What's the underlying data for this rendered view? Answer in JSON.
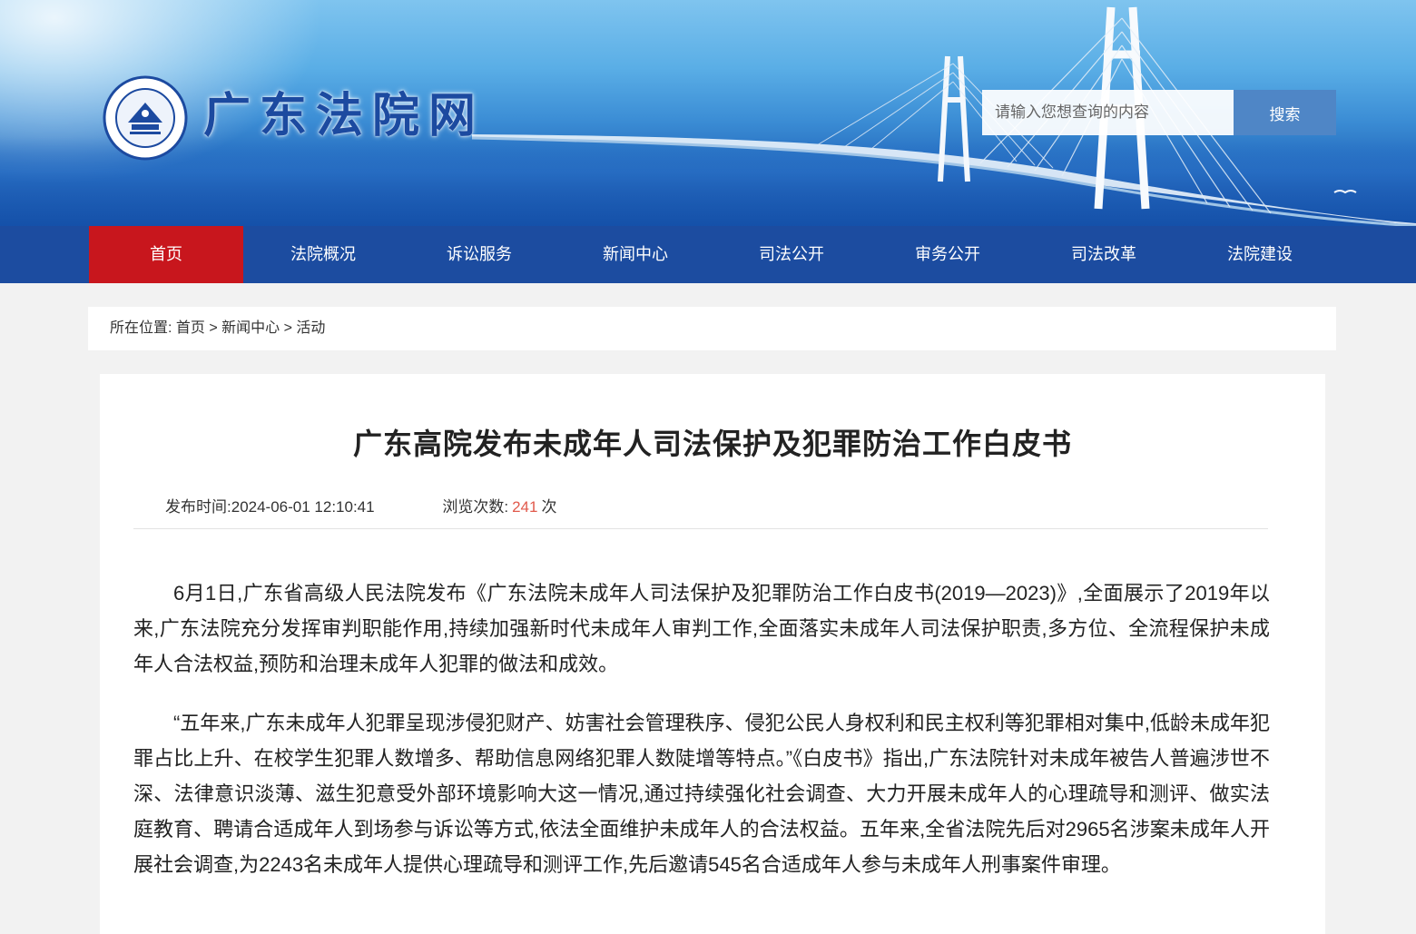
{
  "header": {
    "site_title": "广东法院网",
    "logo_text": "广东省高级人民法院",
    "search": {
      "placeholder": "请输入您想查询的内容",
      "button": "搜索"
    }
  },
  "nav": {
    "items": [
      {
        "label": "首页",
        "active": true
      },
      {
        "label": "法院概况"
      },
      {
        "label": "诉讼服务"
      },
      {
        "label": "新闻中心"
      },
      {
        "label": "司法公开"
      },
      {
        "label": "审务公开"
      },
      {
        "label": "司法改革"
      },
      {
        "label": "法院建设"
      }
    ]
  },
  "breadcrumb": {
    "prefix": "所在位置:",
    "items": [
      "首页",
      "新闻中心",
      "活动"
    ],
    "separator": " > "
  },
  "article": {
    "title": "广东高院发布未成年人司法保护及犯罪防治工作白皮书",
    "publish_label": "发布时间:",
    "publish_time": "2024-06-01 12:10:41",
    "views_label": "浏览次数:",
    "views_count": "241",
    "views_unit": "次",
    "paragraphs": [
      "6月1日,广东省高级人民法院发布《广东法院未成年人司法保护及犯罪防治工作白皮书(2019—2023)》,全面展示了2019年以来,广东法院充分发挥审判职能作用,持续加强新时代未成年人审判工作,全面落实未成年人司法保护职责,多方位、全流程保护未成年人合法权益,预防和治理未成年人犯罪的做法和成效。",
      "“五年来,广东未成年人犯罪呈现涉侵犯财产、妨害社会管理秩序、侵犯公民人身权利和民主权利等犯罪相对集中,低龄未成年犯罪占比上升、在校学生犯罪人数增多、帮助信息网络犯罪人数陡增等特点。”《白皮书》指出,广东法院针对未成年被告人普遍涉世不深、法律意识淡薄、滋生犯意受外部环境影响大这一情况,通过持续强化社会调查、大力开展未成年人的心理疏导和测评、做实法庭教育、聘请合适成年人到场参与诉讼等方式,依法全面维护未成年人的合法权益。五年来,全省法院先后对2965名涉案未成年人开展社会调查,为2243名未成年人提供心理疏导和测评工作,先后邀请545名合适成年人参与未成年人刑事案件审理。"
    ]
  },
  "colors": {
    "nav_bg": "#1c4ca0",
    "nav_active": "#c8161d",
    "view_count": "#e15a4c",
    "search_button": "#4f86c6",
    "title_blue": "#1c4aa0"
  }
}
